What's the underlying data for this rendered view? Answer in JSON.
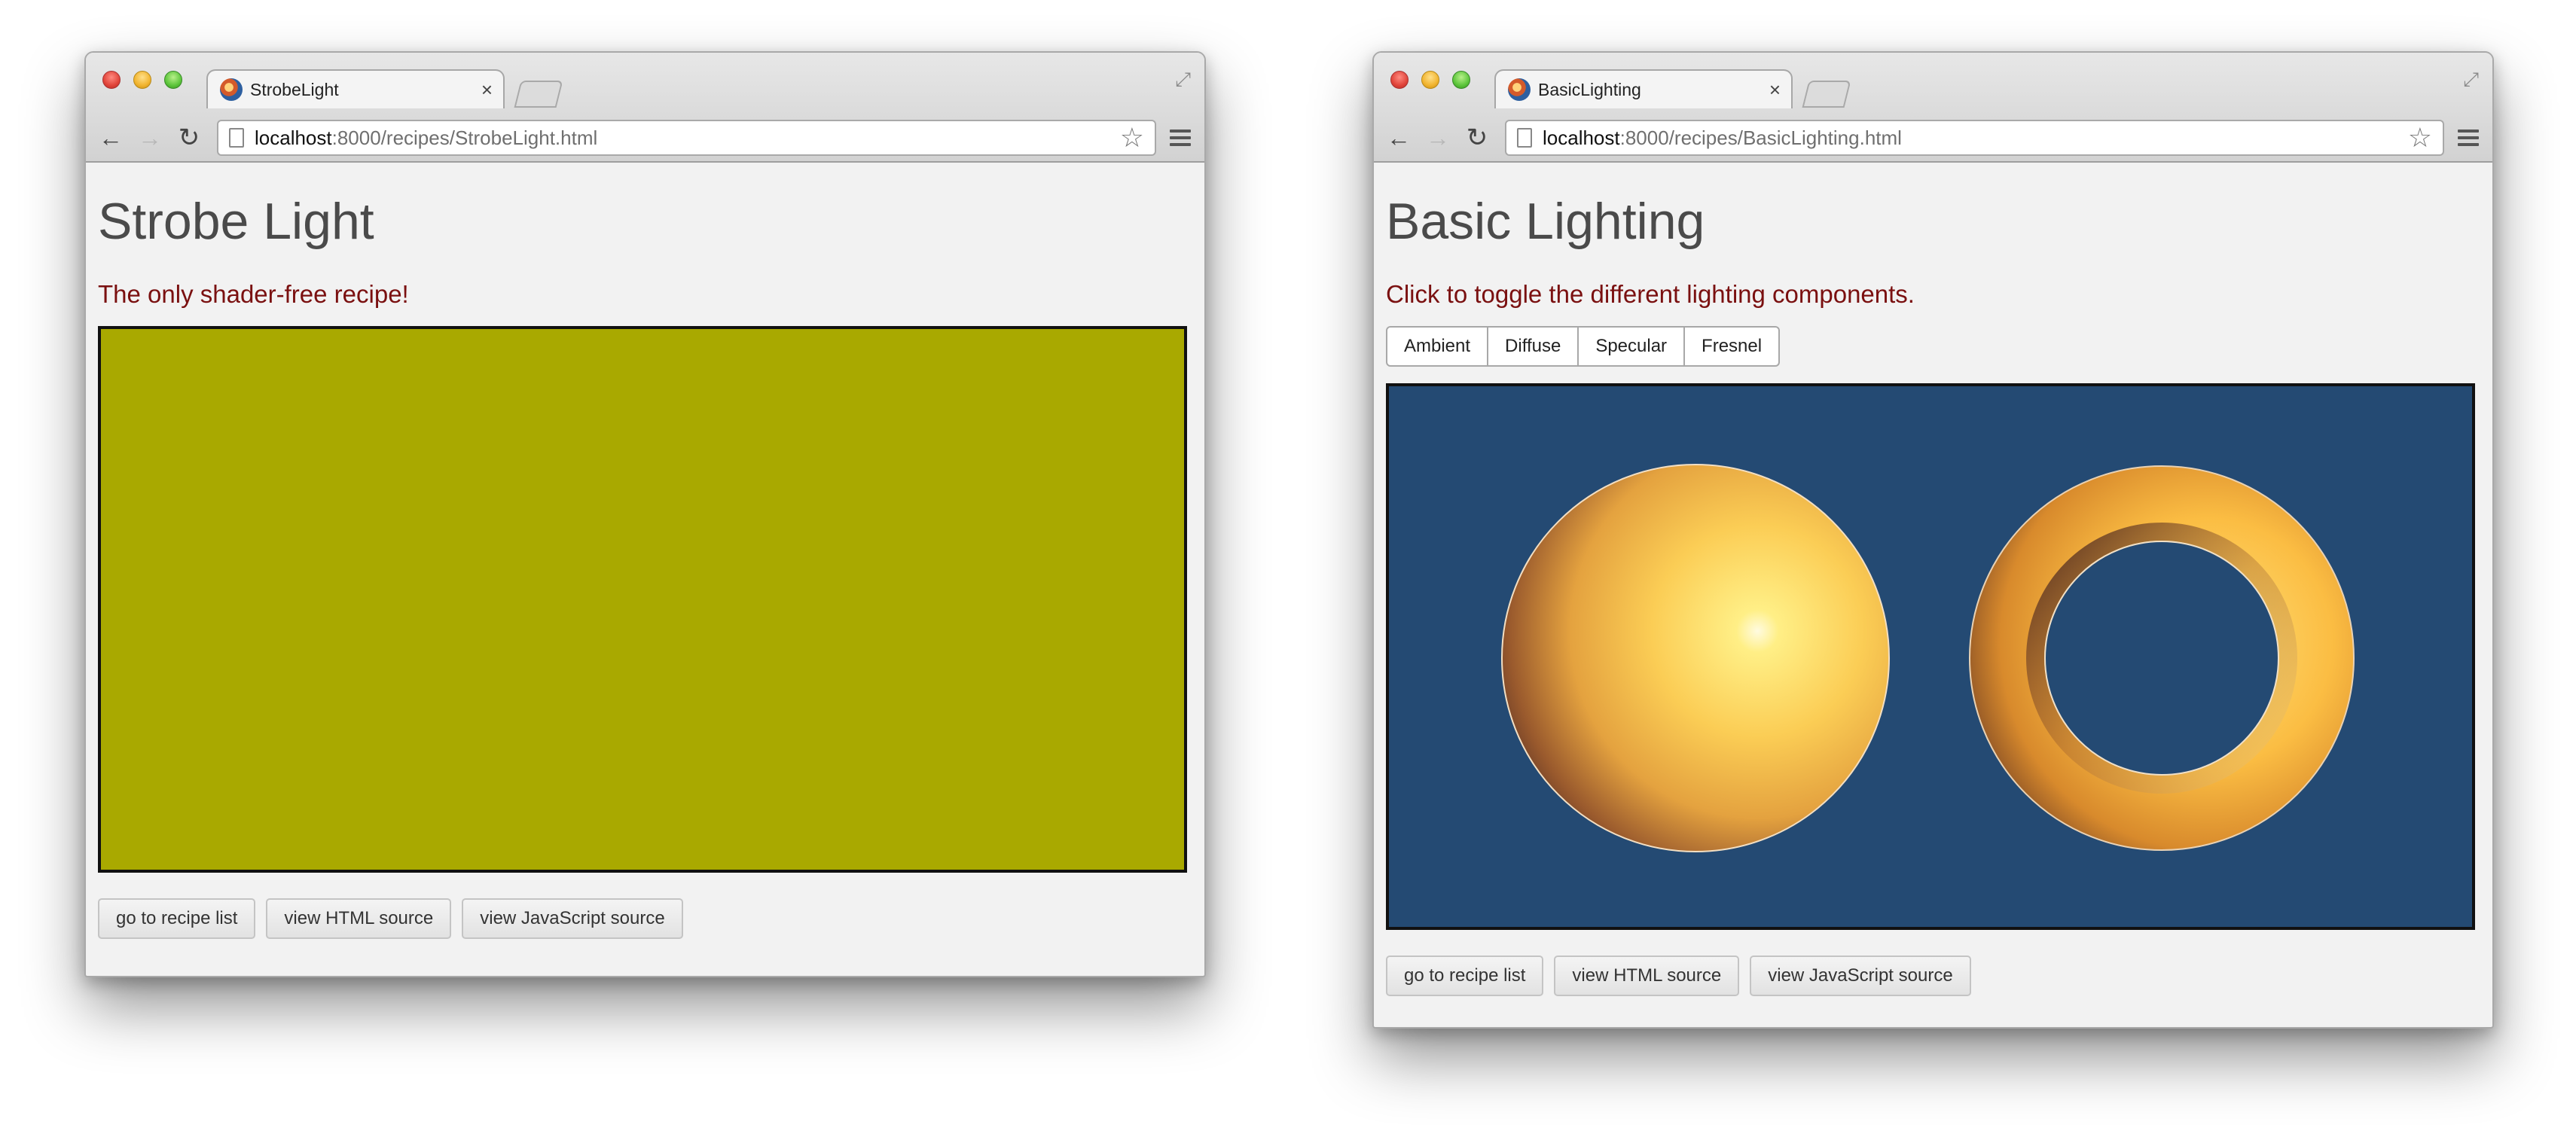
{
  "window1": {
    "tab_title": "StrobeLight",
    "tab_close": "×",
    "url_host": "localhost",
    "url_rest": ":8000/recipes/StrobeLight.html",
    "heading": "Strobe Light",
    "subtitle": "The only shader-free recipe!",
    "canvas_color": "#a9a900",
    "footer_buttons": [
      "go to recipe list",
      "view HTML source",
      "view JavaScript source"
    ]
  },
  "window2": {
    "tab_title": "BasicLighting",
    "tab_close": "×",
    "url_host": "localhost",
    "url_rest": ":8000/recipes/BasicLighting.html",
    "heading": "Basic Lighting",
    "subtitle": "Click to toggle the different lighting components.",
    "toggle_buttons": [
      "Ambient",
      "Diffuse",
      "Specular",
      "Fresnel"
    ],
    "canvas_color": "#244a73",
    "object_color": "#f5b944",
    "footer_buttons": [
      "go to recipe list",
      "view HTML source",
      "view JavaScript source"
    ]
  },
  "icons": {
    "back": "←",
    "forward": "→",
    "reload": "↻",
    "star": "☆",
    "expand": "⤢"
  }
}
